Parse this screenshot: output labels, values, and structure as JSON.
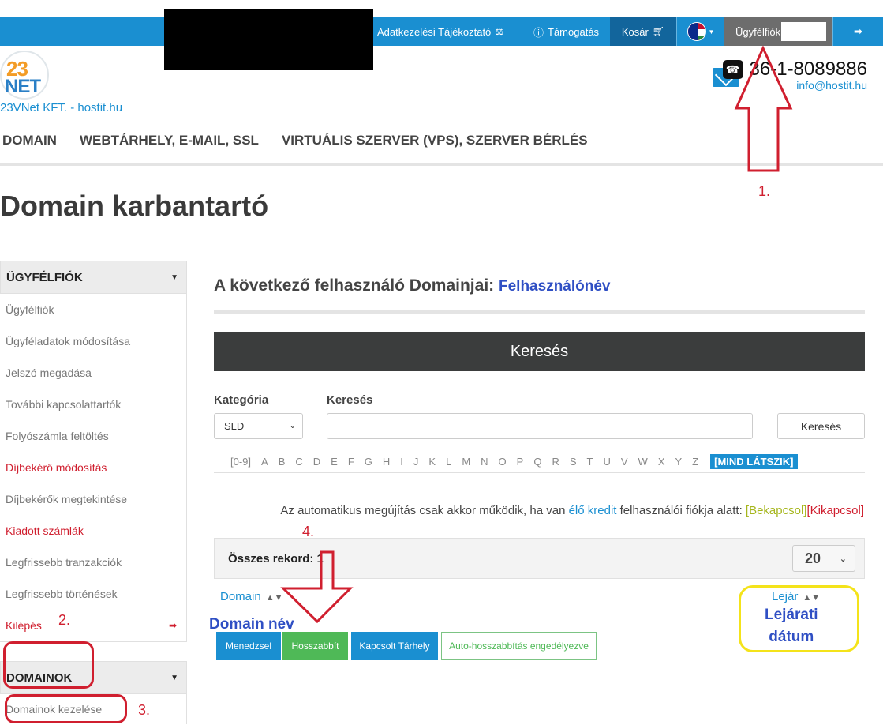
{
  "topbar": {
    "privacy": "Adatkezelési Tájékoztató",
    "support": "Támogatás",
    "cart": "Kosár",
    "account": "Ügyfélfiók"
  },
  "header": {
    "logo_top": "23",
    "logo_bottom": "NET",
    "company": "23VNet KFT. - hostit.hu",
    "phone": "36-1-8089886",
    "email": "info@hostit.hu"
  },
  "nav": {
    "items": [
      "DOMAIN",
      "WEBTÁRHELY, E-MAIL, SSL",
      "VIRTUÁLIS SZERVER (VPS), SZERVER BÉRLÉS"
    ]
  },
  "page_title": "Domain karbantartó",
  "sidebar": {
    "section1": "ÜGYFÉLFIÓK",
    "items": [
      "Ügyfélfiók",
      "Ügyféladatok módosítása",
      "Jelszó megadása",
      "További kapcsolattartók",
      "Folyószámla feltöltés",
      "Díjbekérő módosítás",
      "Díjbekérők megtekintése",
      "Kiadott számlák",
      "Legfrissebb tranzakciók",
      "Legfrissebb történések",
      "Kilépés"
    ],
    "section2": "DOMAINOK",
    "section2_items": [
      "Domainok kezelése"
    ]
  },
  "main": {
    "subtitle": "A következő felhasználó Domainjai:",
    "username": "Felhasználónév",
    "search_header": "Keresés",
    "category_label": "Kategória",
    "search_label": "Keresés",
    "category_value": "SLD",
    "search_button": "Keresés",
    "alphabet": [
      "[0-9]",
      "A",
      "B",
      "C",
      "D",
      "E",
      "F",
      "G",
      "H",
      "I",
      "J",
      "K",
      "L",
      "M",
      "N",
      "O",
      "P",
      "Q",
      "R",
      "S",
      "T",
      "U",
      "V",
      "W",
      "X",
      "Y",
      "Z"
    ],
    "show_all": "[MIND LÁTSZIK]",
    "autorenew_text": "Az automatikus megújítás csak akkor működik, ha van",
    "autorenew_link": "élő kredit",
    "autorenew_text2": "felhasználói fiókja alatt:",
    "autorenew_on": "[Bekapcsol]",
    "autorenew_off": "[Kikapcsol]",
    "total_records": "Összes rekord: 1",
    "page_size": "20",
    "col_domain": "Domain",
    "col_expiry": "Lejár",
    "buttons": {
      "manage": "Menedzsel",
      "renew": "Hosszabbít",
      "hosting": "Kapcsolt Tárhely",
      "auto": "Auto-hosszabbítás engedélyezve"
    }
  },
  "annotations": {
    "n1": "1.",
    "n2": "2.",
    "n3": "3.",
    "n4": "4.",
    "domain_name": "Domain név",
    "expiry_line1": "Lejárati",
    "expiry_line2": "dátum"
  },
  "colors": {
    "topbar": "#1a8fd1",
    "accent_red": "#d01f2f",
    "annotation_blue": "#2f4fc4",
    "annotation_yellow": "#f4e31a",
    "success_green": "#4fb957"
  }
}
